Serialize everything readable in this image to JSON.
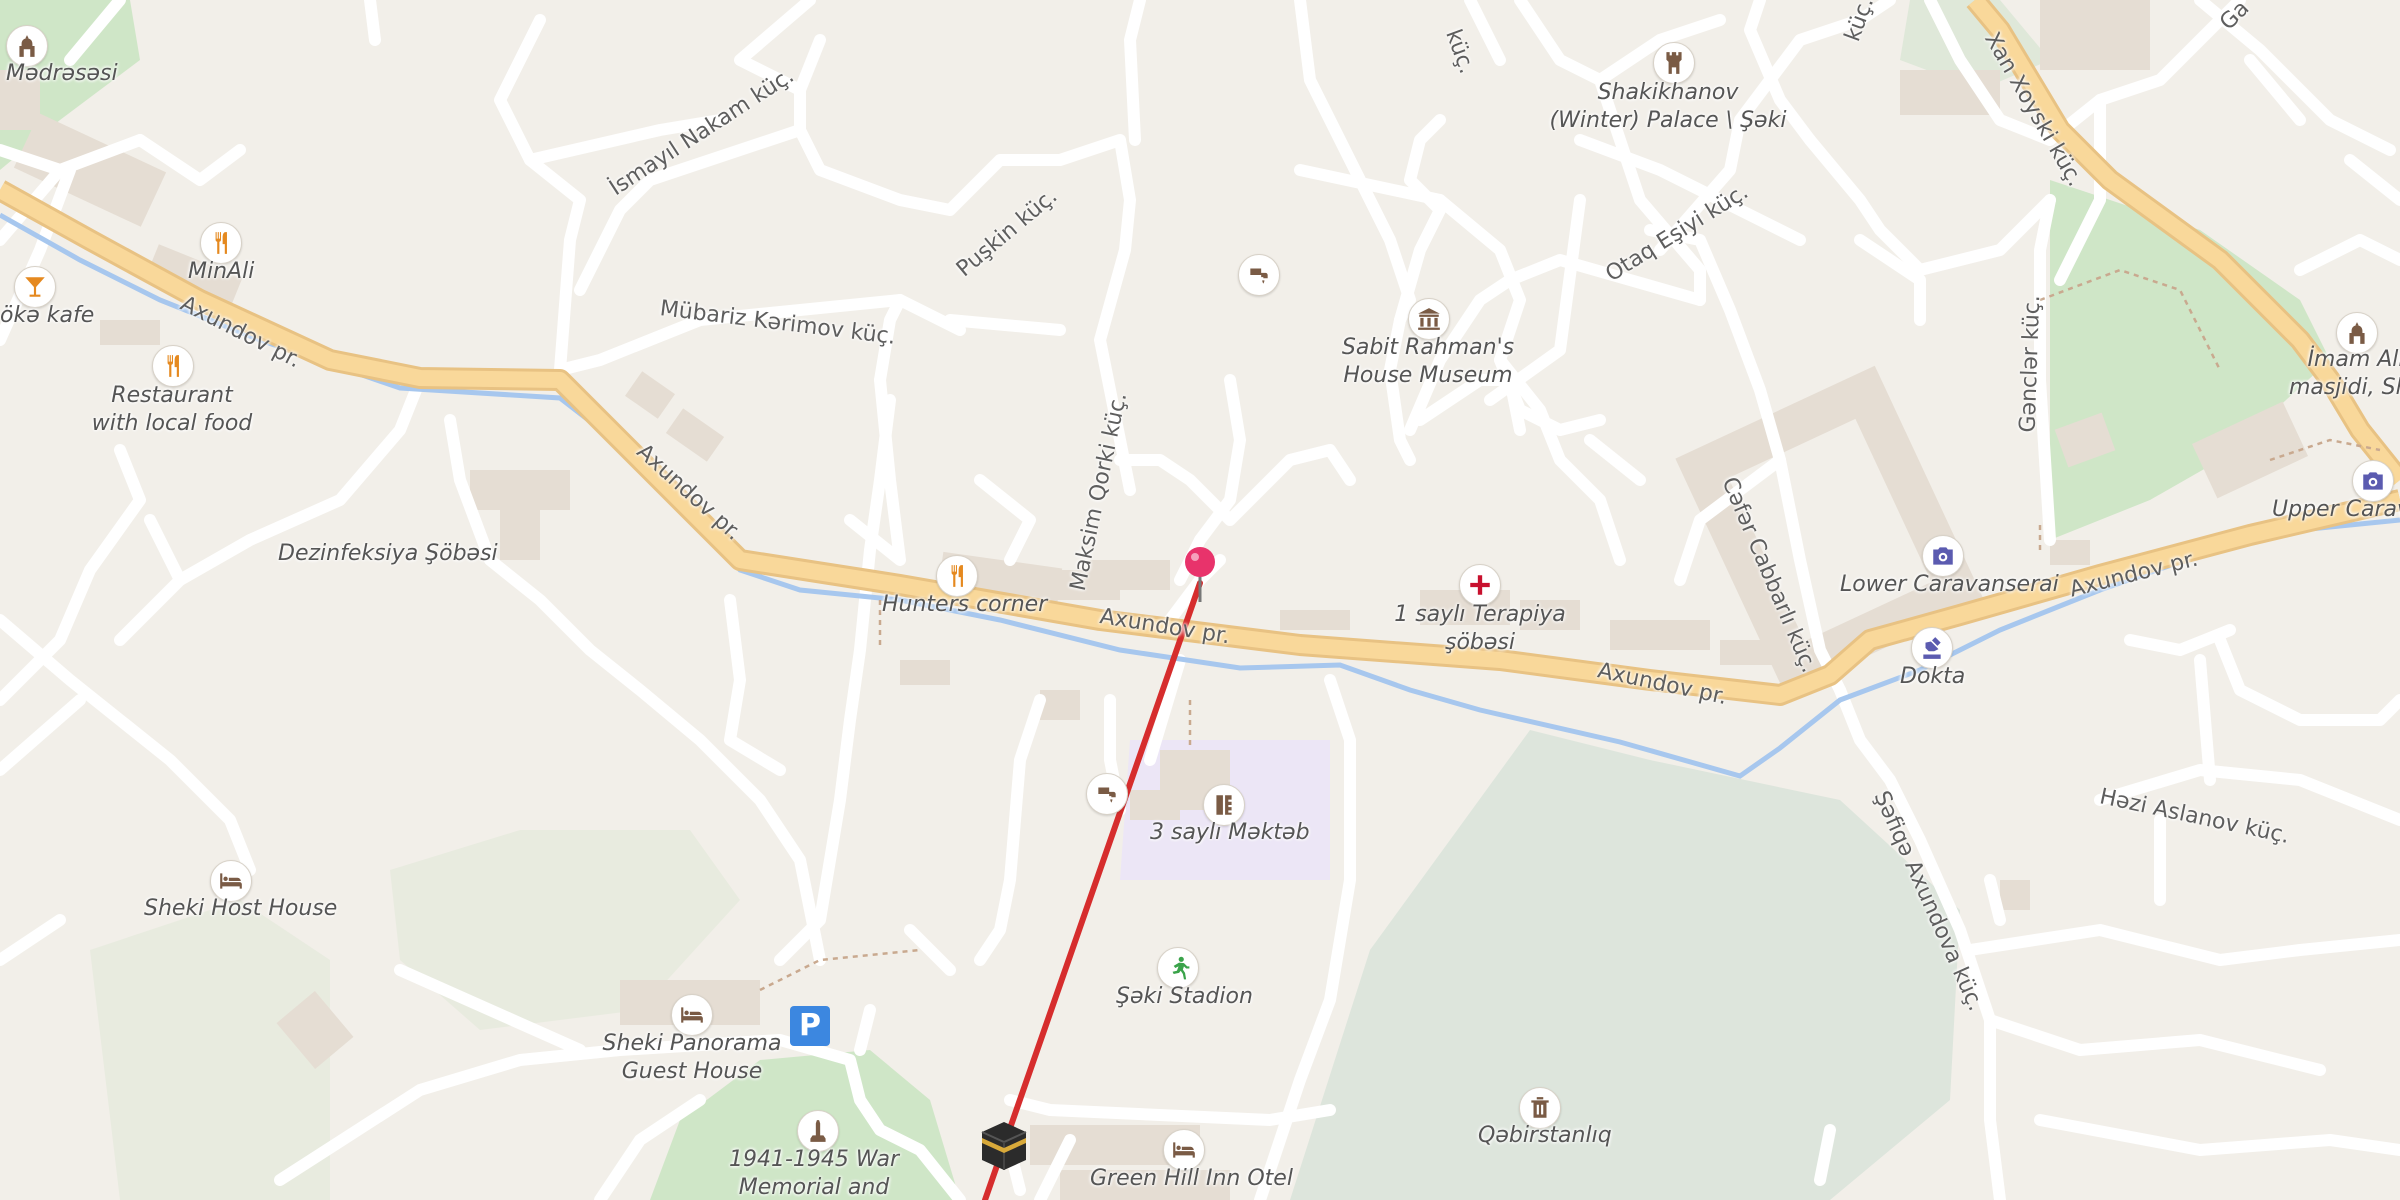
{
  "map": {
    "colors": {
      "background": "#f2efe9",
      "main_road": "#f9d89a",
      "river": "#a7c7ee",
      "park": "#cfe6c7",
      "cemetery": "#dde5dc",
      "school": "#ece6f6",
      "building": "#e5ddd3",
      "route": "#d62d2d",
      "pin": "#e8336b"
    },
    "streets": [
      {
        "id": "axundov-1",
        "label": "Axundov pr."
      },
      {
        "id": "axundov-2",
        "label": "Axundov pr."
      },
      {
        "id": "axundov-3",
        "label": "Axundov pr."
      },
      {
        "id": "axundov-4",
        "label": "Axundov pr."
      },
      {
        "id": "axundov-5",
        "label": "Axundov pr."
      },
      {
        "id": "ismayil",
        "label": "İsmayıl Nakam küç."
      },
      {
        "id": "puskin",
        "label": "Puşkin küç."
      },
      {
        "id": "mubariz",
        "label": "Mübariz Kərimov küç."
      },
      {
        "id": "maksim",
        "label": "Maksim Qorki küç."
      },
      {
        "id": "otaq",
        "label": "Otaq Eşiyi küç."
      },
      {
        "id": "xan",
        "label": "Xan Xoyski küç."
      },
      {
        "id": "gencler",
        "label": "Gənclər küç."
      },
      {
        "id": "cefer",
        "label": "Cəfər Cabbarlı küç."
      },
      {
        "id": "sefiqe",
        "label": "Şəfiqə Axundova küç."
      },
      {
        "id": "hezi",
        "label": "Həzi Aslanov küç."
      },
      {
        "id": "kuc-top",
        "label": "küç."
      },
      {
        "id": "kuc-top2",
        "label": "küç."
      },
      {
        "id": "ga-top",
        "label": "Ga"
      }
    ],
    "places": [
      {
        "id": "medresesi",
        "label": "Mədrəsəsi",
        "icon": "mosque-icon"
      },
      {
        "id": "minali",
        "label": "MinAli",
        "icon": "restaurant-icon"
      },
      {
        "id": "goka-kafe",
        "label": "ökə kafe",
        "icon": "cocktail-icon"
      },
      {
        "id": "restaurant-local",
        "label": "Restaurant\nwith local food",
        "icon": "restaurant-icon"
      },
      {
        "id": "dezinfeksiya",
        "label": "Dezinfeksiya Şöbəsi"
      },
      {
        "id": "hunters",
        "label": "Hunters corner",
        "icon": "restaurant-icon"
      },
      {
        "id": "shakikhanov",
        "label": "Shakikhanov\n(Winter) Palace \\ Şəki",
        "icon": "castle-icon"
      },
      {
        "id": "sabit",
        "label": "Sabit Rahman's\nHouse Museum",
        "icon": "museum-icon"
      },
      {
        "id": "terapiya",
        "label": "1 saylı Terapiya\nşöbəsi",
        "icon": "hospital-icon"
      },
      {
        "id": "lower-caravanserai",
        "label": "Lower Caravanserai",
        "icon": "camera-icon"
      },
      {
        "id": "dokta",
        "label": "Dokta",
        "icon": "pharmacy-icon"
      },
      {
        "id": "imam-ali",
        "label": "İmam Ali\nmasjidi, She",
        "icon": "mosque-icon"
      },
      {
        "id": "upper-caravanserai",
        "label": "Upper Carav",
        "icon": "camera-icon"
      },
      {
        "id": "mekteb",
        "label": "3 saylı Məktəb",
        "icon": "school-icon"
      },
      {
        "id": "stadion",
        "label": "Şəki Stadion",
        "icon": "sports-icon"
      },
      {
        "id": "sheki-host",
        "label": "Sheki Host House",
        "icon": "hotel-icon"
      },
      {
        "id": "sheki-panorama",
        "label": "Sheki Panorama\nGuest House",
        "icon": "hotel-icon"
      },
      {
        "id": "memorial",
        "label": "1941-1945 War\nMemorial and",
        "icon": "monument-icon"
      },
      {
        "id": "green-hill",
        "label": "Green Hill Inn Otel",
        "icon": "hotel-icon"
      },
      {
        "id": "qebiristanliq",
        "label": "Qəbirstanlıq",
        "icon": "cemetery-icon"
      }
    ],
    "parking_label": "P"
  }
}
